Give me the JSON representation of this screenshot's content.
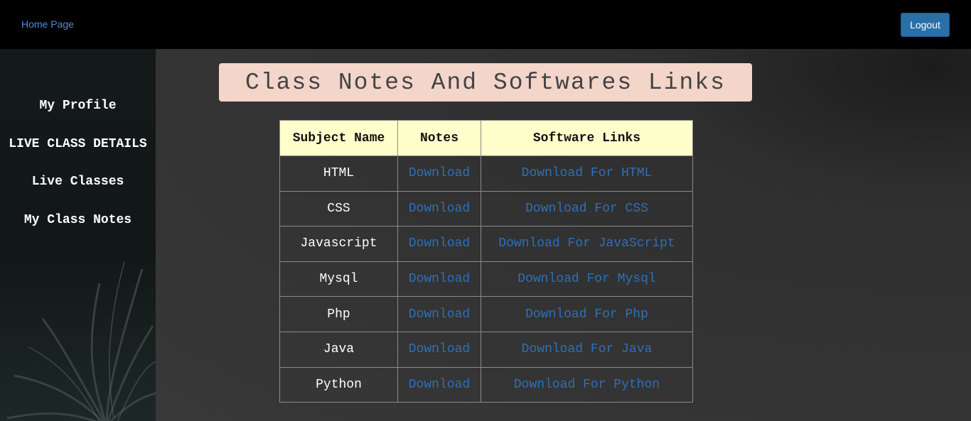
{
  "topbar": {
    "home_label": "Home Page",
    "logout_label": "Logout"
  },
  "sidebar": {
    "items": [
      {
        "label": "My Profile"
      },
      {
        "label": "LIVE CLASS DETAILS"
      },
      {
        "label": "Live Classes"
      },
      {
        "label": "My Class Notes"
      }
    ]
  },
  "main": {
    "title": "Class Notes And Softwares Links",
    "table": {
      "headers": [
        "Subject Name",
        "Notes",
        "Software Links"
      ],
      "rows": [
        {
          "subject": "HTML",
          "notes": "Download",
          "software": "Download For HTML"
        },
        {
          "subject": "CSS",
          "notes": "Download",
          "software": "Download For CSS"
        },
        {
          "subject": "Javascript",
          "notes": "Download",
          "software": "Download For JavaScript"
        },
        {
          "subject": "Mysql",
          "notes": "Download",
          "software": "Download For Mysql"
        },
        {
          "subject": "Php",
          "notes": "Download",
          "software": "Download For Php"
        },
        {
          "subject": "Java",
          "notes": "Download",
          "software": "Download For Java"
        },
        {
          "subject": "Python",
          "notes": "Download",
          "software": "Download For Python"
        }
      ]
    }
  },
  "colors": {
    "topbar_bg": "#000000",
    "link": "#2f6fb8",
    "title_bg": "#f3d5ca",
    "header_bg": "#ffffcc",
    "logout_bg": "#2a6fa8"
  }
}
